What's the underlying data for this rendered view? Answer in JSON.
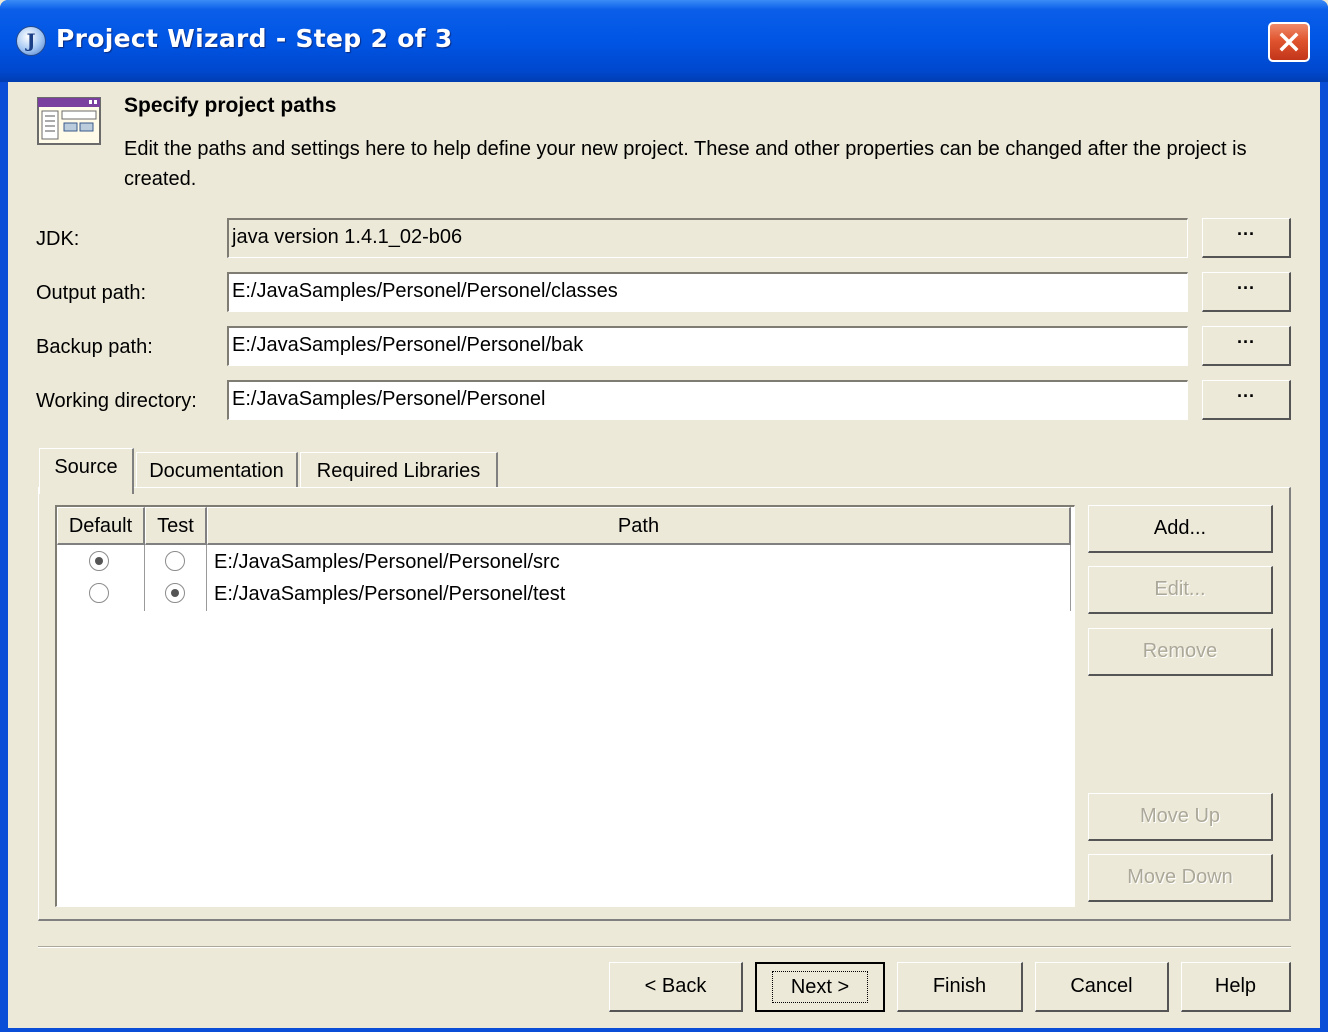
{
  "window": {
    "title": "Project Wizard - Step 2 of 3",
    "title_icon": "J",
    "colors": {
      "titlebar": "#0055E5",
      "close": "#E0552F",
      "face": "#ECE9D8"
    }
  },
  "header": {
    "title": "Specify project paths",
    "description": "Edit the paths and settings here to help define your new project. These and other properties can be changed after the project is created.",
    "icon": "wizard-window-icon"
  },
  "fields": {
    "jdk": {
      "label": "JDK:",
      "value": "java version 1.4.1_02-b06",
      "button": "···"
    },
    "output_path": {
      "label": "Output path:",
      "value": "E:/JavaSamples/Personel/Personel/classes",
      "button": "···"
    },
    "backup_path": {
      "label": "Backup path:",
      "value": "E:/JavaSamples/Personel/Personel/bak",
      "button": "···"
    },
    "working_directory": {
      "label": "Working directory:",
      "value": "E:/JavaSamples/Personel/Personel",
      "button": "···"
    }
  },
  "tabs": [
    {
      "label": "Source",
      "active": true
    },
    {
      "label": "Documentation",
      "active": false
    },
    {
      "label": "Required Libraries",
      "active": false
    }
  ],
  "table": {
    "columns": [
      "Default",
      "Test",
      "Path"
    ],
    "rows": [
      {
        "default": true,
        "test": false,
        "path": "E:/JavaSamples/Personel/Personel/src"
      },
      {
        "default": false,
        "test": true,
        "path": "E:/JavaSamples/Personel/Personel/test"
      }
    ]
  },
  "side_buttons": {
    "add": "Add...",
    "edit": "Edit...",
    "remove": "Remove",
    "move_up": "Move Up",
    "move_down": "Move Down"
  },
  "footer": {
    "back": "< Back",
    "next": "Next >",
    "finish": "Finish",
    "cancel": "Cancel",
    "help": "Help"
  }
}
